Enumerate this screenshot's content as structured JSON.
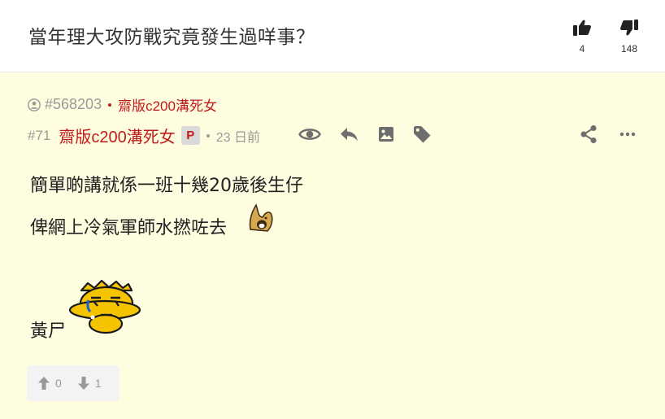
{
  "thread": {
    "title": "當年理大攻防戰究竟發生過咩事？",
    "like_count": "4",
    "dislike_count": "148"
  },
  "thread_meta": {
    "thread_id": "#568203",
    "author": "齋版c200溝死女"
  },
  "post": {
    "floor": "#71",
    "author": "齋版c200溝死女",
    "badge": "P",
    "time": "23 日前",
    "lines": [
      "簡單啲講就係一班十幾20歲後生仔",
      "俾網上冷氣軍師水撚咗去",
      "黃尸"
    ],
    "upvotes": "0",
    "downvotes": "1"
  },
  "colors": {
    "accent_red": "#c11b1b",
    "post_bg": "#fffde0",
    "meta_grey": "#9a9a9a"
  },
  "icons": [
    "thumb-up-icon",
    "thumb-down-icon",
    "user-icon",
    "eye-icon",
    "reply-icon",
    "image-icon",
    "tag-icon",
    "share-icon",
    "more-icon",
    "arrow-up-icon",
    "arrow-down-icon"
  ]
}
